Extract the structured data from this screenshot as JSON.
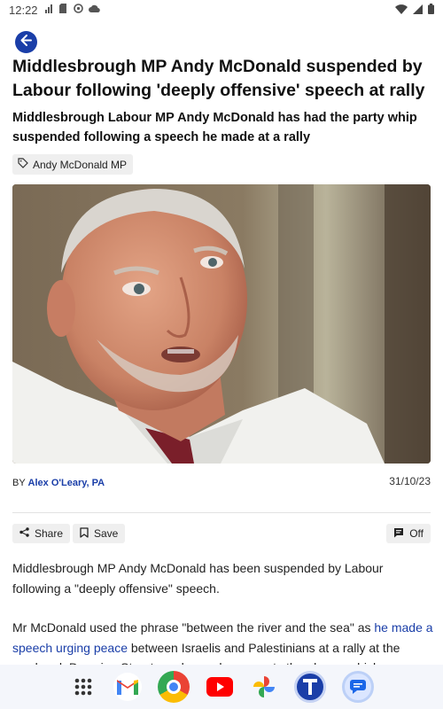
{
  "status_bar": {
    "time": "12:22"
  },
  "article": {
    "headline": "Middlesbrough MP Andy McDonald suspended by Labour following 'deeply offensive' speech at rally",
    "subheadline": "Middlesbrough Labour MP Andy McDonald has had the party whip suspended following a speech he made at a rally",
    "tag": "Andy McDonald MP",
    "byline_prefix": "BY",
    "author": "Alex O'Leary, PA",
    "date": "31/10/23",
    "actions": {
      "share": "Share",
      "save": "Save",
      "toggle": "Off"
    },
    "paragraph_1": "Middlesbrough MP Andy McDonald has been suspended by Labour following a \"deeply offensive\" speech.",
    "paragraph_2_before": "Mr McDonald used the phrase \"between the river and the sea\" as ",
    "paragraph_2_link": "he made a speech urging peace",
    "paragraph_2_after": " between Israelis and Palestinians at a rally at the weekend. Downing Street condemned comments the phrase which"
  },
  "colors": {
    "accent": "#1a3ea8",
    "tag_bg": "#efefef"
  },
  "dock": {
    "apps": [
      "app-drawer-icon",
      "gmail-icon",
      "chrome-icon",
      "youtube-icon",
      "photos-icon",
      "t-news-app-icon",
      "messages-icon"
    ]
  }
}
